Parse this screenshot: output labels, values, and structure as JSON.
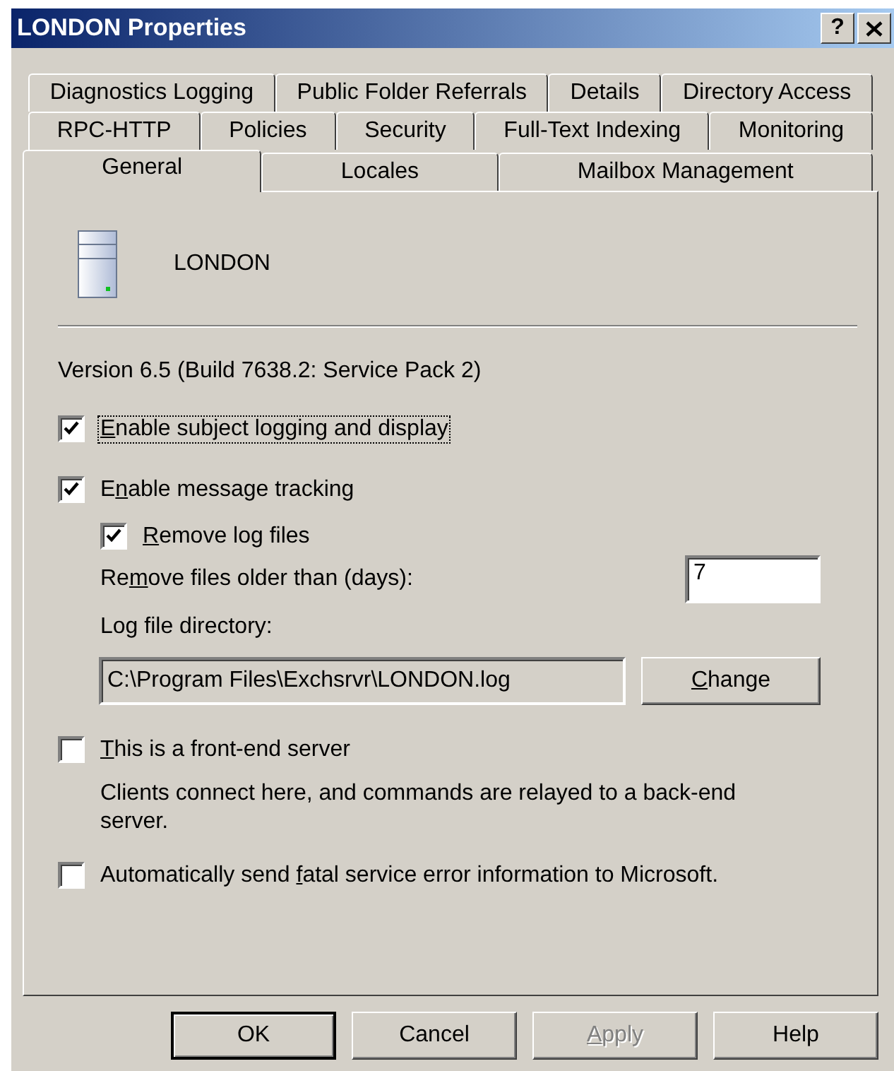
{
  "window": {
    "title": "LONDON Properties",
    "help_glyph": "?"
  },
  "tab_rows": [
    [
      {
        "label": "Diagnostics Logging",
        "selected": false
      },
      {
        "label": "Public Folder Referrals",
        "selected": false
      },
      {
        "label": "Details",
        "selected": false
      },
      {
        "label": "Directory Access",
        "selected": false
      }
    ],
    [
      {
        "label": "RPC-HTTP",
        "selected": false
      },
      {
        "label": "Policies",
        "selected": false
      },
      {
        "label": "Security",
        "selected": false
      },
      {
        "label": "Full-Text Indexing",
        "selected": false
      },
      {
        "label": "Monitoring",
        "selected": false
      }
    ],
    [
      {
        "label": "General",
        "selected": true
      },
      {
        "label": "Locales",
        "selected": false
      },
      {
        "label": "Mailbox Management",
        "selected": false
      }
    ]
  ],
  "server": {
    "name": "LONDON"
  },
  "version": "Version 6.5 (Build 7638.2: Service Pack 2)",
  "subject_logging": {
    "label": [
      {
        "text": "E",
        "underlined": true
      },
      {
        "text": "nable subject logging and display",
        "underlined": false
      }
    ],
    "checked": true,
    "focused": true
  },
  "message_tracking": {
    "label": [
      {
        "text": "E",
        "underlined": false
      },
      {
        "text": "n",
        "underlined": true
      },
      {
        "text": "able message tracking",
        "underlined": false
      }
    ],
    "checked": true,
    "focused": false
  },
  "remove_logs": {
    "label": [
      {
        "text": "R",
        "underlined": true
      },
      {
        "text": "emove log files",
        "underlined": false
      }
    ],
    "checked": true,
    "focused": false
  },
  "remove_days": {
    "label": [
      {
        "text": "Re",
        "underlined": false
      },
      {
        "text": "m",
        "underlined": true
      },
      {
        "text": "ove files older than (days):",
        "underlined": false
      }
    ],
    "value": "7"
  },
  "log_directory": {
    "label": "Log file directory:",
    "value": "C:\\Program Files\\Exchsrvr\\LONDON.log",
    "button": {
      "label": [
        {
          "text": "C",
          "underlined": true
        },
        {
          "text": "hange",
          "underlined": false
        }
      ]
    }
  },
  "front_end": {
    "label": [
      {
        "text": "T",
        "underlined": true
      },
      {
        "text": "his is a front-end server",
        "underlined": false
      }
    ],
    "checked": false,
    "focused": false,
    "description": "Clients connect here, and commands are relayed to a back-end server."
  },
  "error_reporting": {
    "label": [
      {
        "text": "Automatically send ",
        "underlined": false
      },
      {
        "text": "f",
        "underlined": true
      },
      {
        "text": "atal service error information to Microsoft.",
        "underlined": false
      }
    ],
    "checked": false,
    "focused": false
  },
  "buttons": [
    {
      "label": [
        {
          "text": "OK",
          "underlined": false
        }
      ],
      "default": true,
      "disabled": false
    },
    {
      "label": [
        {
          "text": "Cancel",
          "underlined": false
        }
      ],
      "default": false,
      "disabled": false
    },
    {
      "label": [
        {
          "text": "A",
          "underlined": true
        },
        {
          "text": "pply",
          "underlined": false
        }
      ],
      "default": false,
      "disabled": true
    },
    {
      "label": [
        {
          "text": "Help",
          "underlined": false
        }
      ],
      "default": false,
      "disabled": false
    }
  ]
}
